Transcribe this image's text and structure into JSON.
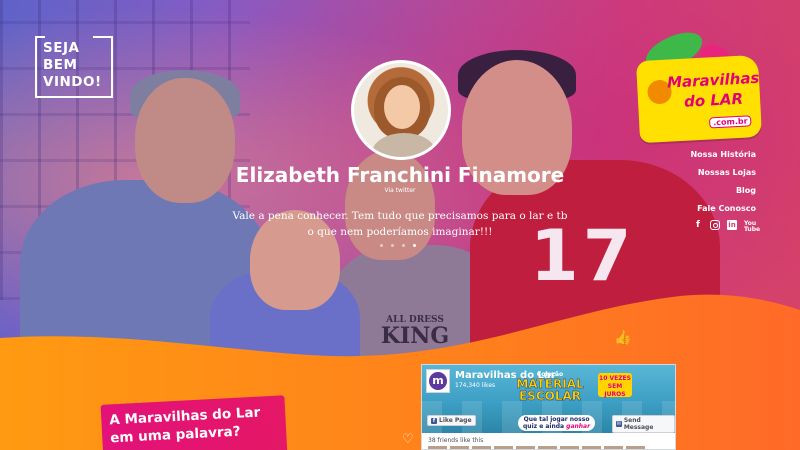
{
  "welcome": {
    "lines": [
      "SEJA",
      "BEM",
      "VINDO!"
    ]
  },
  "testimonial": {
    "name": "Elizabeth Franchini Finamore",
    "source": "Via twitter",
    "quote": "Vale a pena conhecer. Tem tudo que precisamos para o lar e tb o que nem poderíamos imaginar!!!",
    "slides_total": 4,
    "slide_active": 4
  },
  "hero_photo": {
    "shirt_text_small": "ALL DRESS",
    "shirt_text_big": "KING",
    "jersey_number": "17"
  },
  "logo": {
    "line1": "Maravilhas",
    "line2": "do LAR",
    "domain": ".com.br"
  },
  "nav": {
    "items": [
      {
        "label": "Nossa História"
      },
      {
        "label": "Nossas Lojas"
      },
      {
        "label": "Blog"
      },
      {
        "label": "Fale Conosco"
      }
    ]
  },
  "social": {
    "icons": [
      "facebook-icon",
      "instagram-icon",
      "linkedin-icon",
      "youtube-icon"
    ],
    "glyphs": {
      "facebook": "f",
      "linkedin": "in",
      "youtube": "You Tube"
    }
  },
  "section": {
    "heading_line1": "A Maravilhas do Lar",
    "heading_line2": "em uma palavra?"
  },
  "facebook_widget": {
    "page_name": "Maravilhas do Lar",
    "likes": "174,340 likes",
    "logo_letter": "m",
    "campaign_small": "Coleção",
    "campaign_line1": "MATERIAL",
    "campaign_line2": "ESCOLAR",
    "badge": "10 VEZES SEM JUROS",
    "bubble_line1": "Que tal jogar nosso",
    "bubble_line2a": "quiz e ainda ",
    "bubble_line2b": "ganhar",
    "like_button": "Like Page",
    "send_button": "Send Message",
    "friends": "38 friends like this"
  },
  "colors": {
    "accent_pink": "#e2127a",
    "accent_orange": "#ff7a1a",
    "logo_yellow": "#ffe000"
  }
}
